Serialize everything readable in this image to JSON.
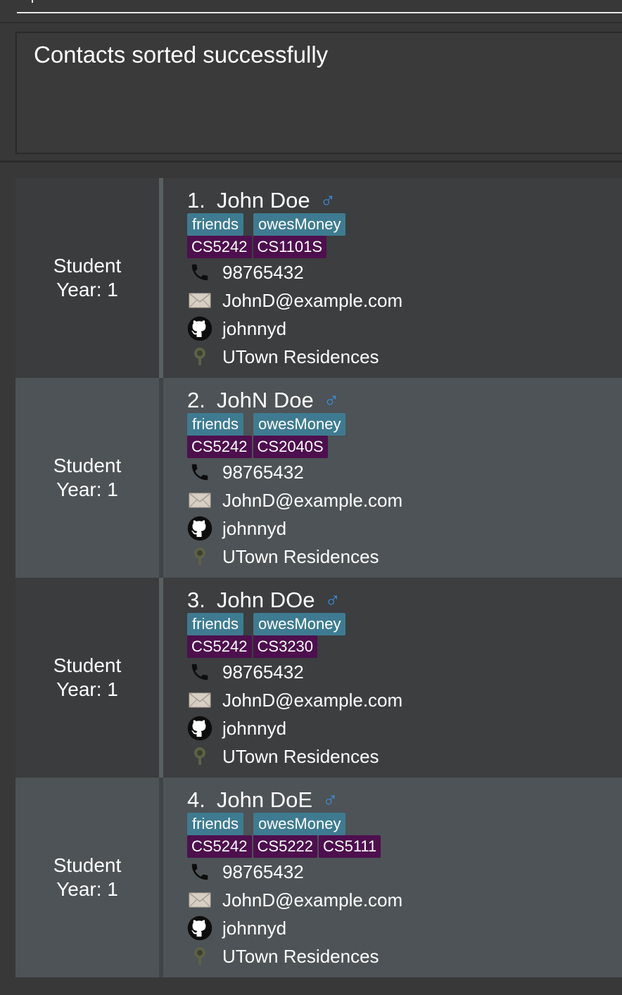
{
  "result": {
    "message": "Contacts sorted successfully"
  },
  "contacts": [
    {
      "index": "1.",
      "name": "John Doe",
      "role": "Student",
      "year": "Year: 1",
      "tags": [
        "friends",
        "owesMoney"
      ],
      "modules": [
        "CS5242",
        "CS1101S"
      ],
      "phone": "98765432",
      "email": "JohnD@example.com",
      "github": "johnnyd",
      "address": "UTown Residences"
    },
    {
      "index": "2.",
      "name": "JohN Doe",
      "role": "Student",
      "year": "Year: 1",
      "tags": [
        "friends",
        "owesMoney"
      ],
      "modules": [
        "CS5242",
        "CS2040S"
      ],
      "phone": "98765432",
      "email": "JohnD@example.com",
      "github": "johnnyd",
      "address": "UTown Residences"
    },
    {
      "index": "3.",
      "name": "John DOe",
      "role": "Student",
      "year": "Year: 1",
      "tags": [
        "friends",
        "owesMoney"
      ],
      "modules": [
        "CS5242",
        "CS3230"
      ],
      "phone": "98765432",
      "email": "JohnD@example.com",
      "github": "johnnyd",
      "address": "UTown Residences"
    },
    {
      "index": "4.",
      "name": "John DoE",
      "role": "Student",
      "year": "Year: 1",
      "tags": [
        "friends",
        "owesMoney"
      ],
      "modules": [
        "CS5242",
        "CS5222",
        "CS5111"
      ],
      "phone": "98765432",
      "email": "JohnD@example.com",
      "github": "johnnyd",
      "address": "UTown Residences"
    }
  ],
  "icons": {
    "gender": "male-icon",
    "phone": "phone-icon",
    "email": "envelope-icon",
    "github": "github-icon",
    "address": "location-pin-icon"
  },
  "colors": {
    "tag": "#3e7b91",
    "module": "#4e0f4e",
    "gender": "#3d8fe0"
  }
}
